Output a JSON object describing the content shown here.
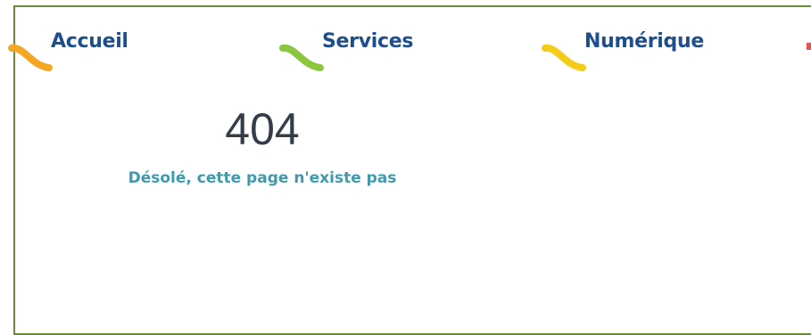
{
  "nav": {
    "items": [
      {
        "label": "Accueil",
        "swoosh_color": "#f5a623"
      },
      {
        "label": "Services",
        "swoosh_color": "#8cc63f"
      },
      {
        "label": "Numérique",
        "swoosh_color": "#f5cc1a"
      }
    ],
    "partial_item_color": "#e05555",
    "label_color": "#1e4f8c"
  },
  "error": {
    "code": "404",
    "message": "Désolé, cette page n'existe pas",
    "message_color": "#3f9aae"
  },
  "colors": {
    "frame_border": "#6a8a3a"
  }
}
